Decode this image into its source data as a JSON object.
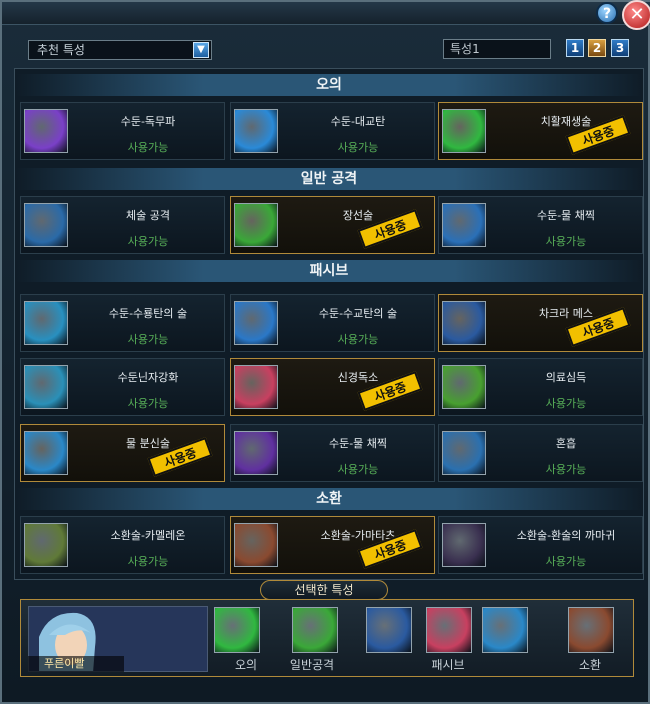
{
  "window": {
    "help_icon": "question-mark-icon",
    "help_glyph": "?",
    "close_icon": "close-icon",
    "close_glyph": "✕"
  },
  "toolbar": {
    "recommend_select": {
      "value": "추천 특성",
      "chevron": "▼"
    },
    "slot_field": {
      "value": "특성1"
    },
    "slot_buttons": [
      "1",
      "2",
      "3"
    ],
    "active_slot": "2"
  },
  "sections": {
    "ougi": {
      "title": "오의"
    },
    "normal": {
      "title": "일반 공격"
    },
    "passive": {
      "title": "패시브"
    },
    "summon": {
      "title": "소환"
    }
  },
  "stamp_label": "사용중",
  "cards": [
    {
      "name": "수둔-독무파",
      "status": "사용가능",
      "in_use": false,
      "icon": "poison-mist-icon",
      "color": "#7a40c8"
    },
    {
      "name": "수둔-대교탄",
      "status": "사용가능",
      "in_use": false,
      "icon": "water-shark-icon",
      "color": "#2a8ad8"
    },
    {
      "name": "치활재생술",
      "status": "",
      "in_use": true,
      "icon": "green-healing-hand-icon",
      "color": "#30b840"
    },
    {
      "name": "체술 공격",
      "status": "사용가능",
      "in_use": false,
      "icon": "fist-icon",
      "color": "#2a6aa8"
    },
    {
      "name": "장선술",
      "status": "",
      "in_use": true,
      "icon": "green-chakra-palm-icon",
      "color": "#3aa838"
    },
    {
      "name": "수둔-물 채찍",
      "status": "사용가능",
      "in_use": false,
      "icon": "water-whip-icon",
      "color": "#2a70b8"
    },
    {
      "name": "수둔-수룡탄의 술",
      "status": "사용가능",
      "in_use": false,
      "icon": "water-dragon-icon",
      "color": "#2890c0"
    },
    {
      "name": "수둔-수교탄의 술",
      "status": "사용가능",
      "in_use": false,
      "icon": "water-shark-icon",
      "color": "#2a78c8"
    },
    {
      "name": "차크라 메스",
      "status": "",
      "in_use": true,
      "icon": "chakra-scalpel-icon",
      "color": "#2a5aa0"
    },
    {
      "name": "수둔닌자강화",
      "status": "사용가능",
      "in_use": false,
      "icon": "water-kanji-icon",
      "color": "#2a90b8"
    },
    {
      "name": "신경독소",
      "status": "",
      "in_use": true,
      "icon": "brain-toxin-icon",
      "color": "#c84060"
    },
    {
      "name": "의료심득",
      "status": "사용가능",
      "in_use": false,
      "icon": "medical-scalpel-icon",
      "color": "#48a030"
    },
    {
      "name": "물 분신술",
      "status": "",
      "in_use": true,
      "icon": "water-clone-icon",
      "color": "#2a88c8"
    },
    {
      "name": "수둔-물 채찍",
      "status": "사용가능",
      "in_use": false,
      "icon": "purple-blade-icon",
      "color": "#6030a0"
    },
    {
      "name": "혼흡",
      "status": "사용가능",
      "in_use": false,
      "icon": "blue-palm-icon",
      "color": "#2a70b0"
    },
    {
      "name": "소환술-카멜레온",
      "status": "사용가능",
      "in_use": false,
      "icon": "chameleon-icon",
      "color": "#607a38"
    },
    {
      "name": "소환술-가마타츠",
      "status": "",
      "in_use": true,
      "icon": "toad-icon",
      "color": "#8a4a30"
    },
    {
      "name": "소환술-환술의 까마귀",
      "status": "사용가능",
      "in_use": false,
      "icon": "crow-icon",
      "color": "#3a3050"
    }
  ],
  "selected": {
    "tab_label": "선택한 특성",
    "character_name": "푸른이빨",
    "character_icon": "character-portrait",
    "groups": [
      {
        "label": "오의"
      },
      {
        "label": "일반공격"
      },
      {
        "label": "패시브"
      },
      {
        "label": "소환"
      }
    ],
    "icons": [
      {
        "icon": "green-healing-hand-icon",
        "color": "#30b840"
      },
      {
        "icon": "green-chakra-palm-icon",
        "color": "#3aa838"
      },
      {
        "icon": "chakra-scalpel-icon",
        "color": "#2a5aa0"
      },
      {
        "icon": "brain-toxin-icon",
        "color": "#c84060"
      },
      {
        "icon": "water-clone-icon",
        "color": "#2a88c8"
      },
      {
        "icon": "toad-icon",
        "color": "#8a4a30"
      }
    ]
  }
}
